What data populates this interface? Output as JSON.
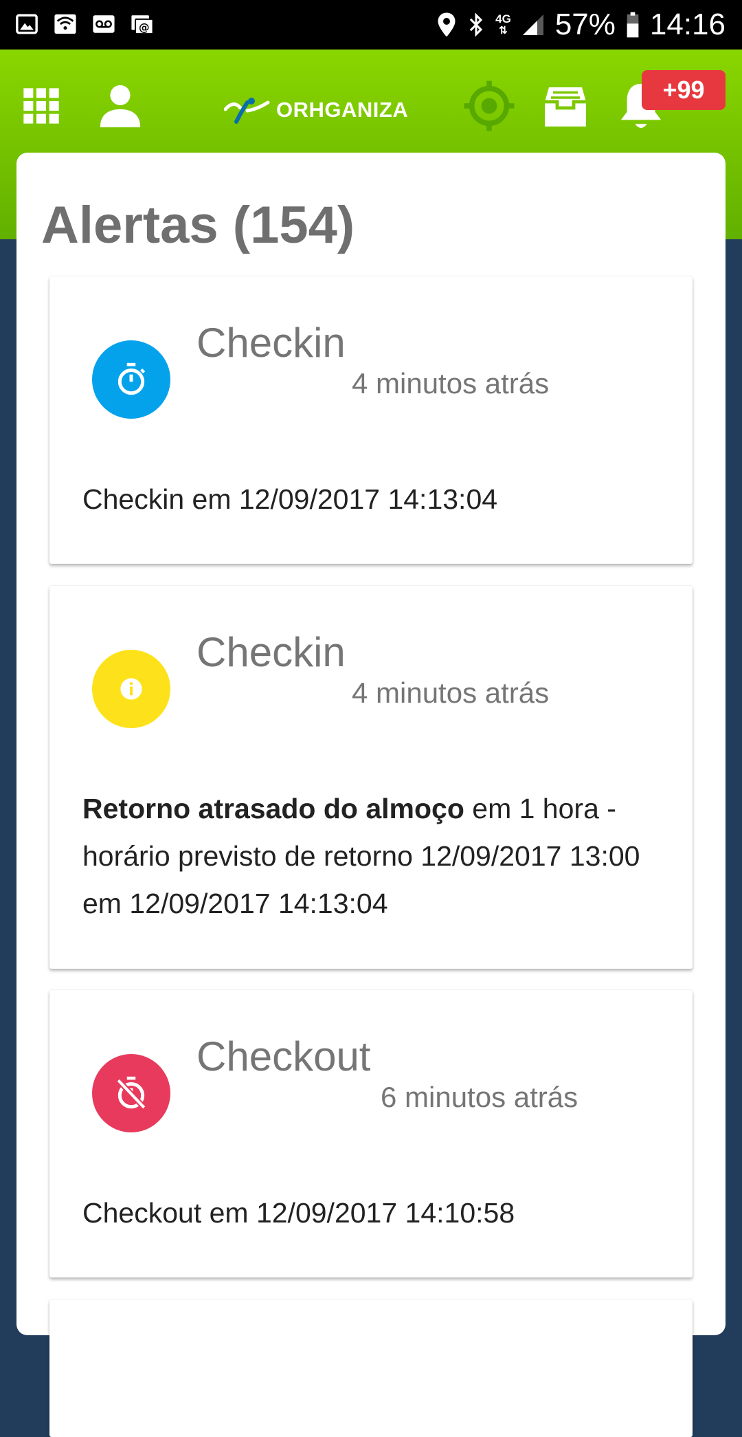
{
  "status_bar": {
    "network_type": "4G",
    "battery": "57%",
    "time": "14:16"
  },
  "header": {
    "app_name": "ORHGANIZA",
    "notification_badge": "+99",
    "icons": {
      "apps": "grid-icon",
      "profile": "person-icon",
      "location": "target-icon",
      "inbox": "inbox-icon",
      "notifications": "bell-icon"
    },
    "colors": {
      "header": "#7cc700",
      "badge": "#e8383f"
    }
  },
  "page": {
    "title": "Alertas (154)"
  },
  "alerts": [
    {
      "title": "Checkin",
      "time": "4 minutos atrás",
      "icon": "stopwatch-icon",
      "icon_color": "#05a2ec",
      "message": "Checkin em 12/09/2017 14:13:04"
    },
    {
      "title": "Checkin",
      "time": "4 minutos atrás",
      "icon": "info-icon",
      "icon_color": "#fde21b",
      "message_bold": "Retorno atrasado do almoço",
      "message": " em 1 hora - horário previsto de retorno 12/09/2017 13:00 em 12/09/2017 14:13:04"
    },
    {
      "title": "Checkout",
      "time": "6 minutos atrás",
      "icon": "stopwatch-off-icon",
      "icon_color": "#e83a5c",
      "message": "Checkout em 12/09/2017 14:10:58"
    }
  ]
}
